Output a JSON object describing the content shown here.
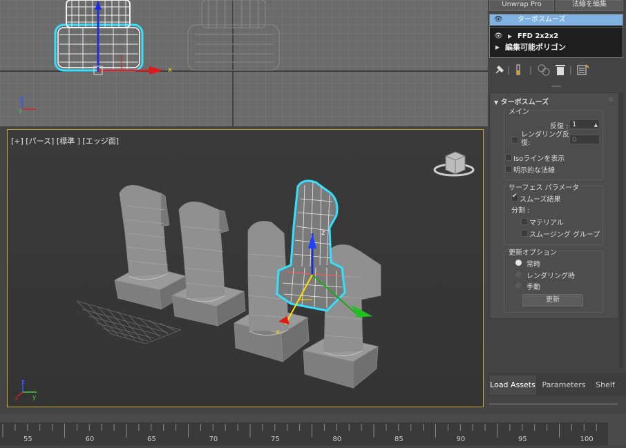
{
  "viewport_top": {
    "axis_x": "x",
    "axis_y": "y",
    "axis_z": "z"
  },
  "viewport_persp": {
    "label": "[+] [パース] [標準 ] [エッジ面]",
    "axis_x": "x",
    "axis_y": "y",
    "axis_z": "z",
    "gizmo_z": "z",
    "gizmo_x": "x"
  },
  "command_panel": {
    "buttons": [
      "Unwrap Pro",
      "法線を編集"
    ],
    "stack": [
      {
        "label": "ターボスムーズ",
        "selected": true
      },
      {
        "label": "FFD 2x2x2",
        "selected": false
      },
      {
        "label": "編集可能ポリゴン",
        "selected": false
      }
    ],
    "toolbar_icons": [
      "pin-stack-icon",
      "show-end-result-icon",
      "make-unique-icon",
      "remove-modifier-icon",
      "configure-modifier-sets-icon"
    ],
    "rollout": {
      "title": "ターボスムーズ",
      "main_group": "メイン",
      "iterations_label": "反復 :",
      "iterations_value": "1",
      "render_iters_label": "レンダリング反\n復:",
      "render_iters_value": "0",
      "isoline_label": "Isoラインを表示",
      "explicit_normals_label": "明示的な法線",
      "surface_group": "サーフェス パラメータ",
      "smooth_result_label": "スムーズ結果",
      "smooth_result_checked": true,
      "separate_label": "分割 :",
      "materials_label": "マテリアル",
      "smoothing_groups_label": "スムージング グループ",
      "update_group": "更新オプション",
      "update_options": [
        {
          "label": "常時",
          "selected": true
        },
        {
          "label": "レンダリング時",
          "selected": false
        },
        {
          "label": "手動",
          "selected": false
        }
      ],
      "update_button": "更新"
    },
    "tabs": [
      "Load Assets",
      "Parameters",
      "Shelf"
    ],
    "active_tab": "Load Assets"
  },
  "timeline": {
    "ticks": [
      "55",
      "60",
      "65",
      "70",
      "75",
      "80",
      "85",
      "90",
      "95",
      "100"
    ]
  },
  "colors": {
    "selection": "#7fb1e3",
    "viewport_border": "#c8a83c",
    "highlight": "#35e0ff"
  }
}
